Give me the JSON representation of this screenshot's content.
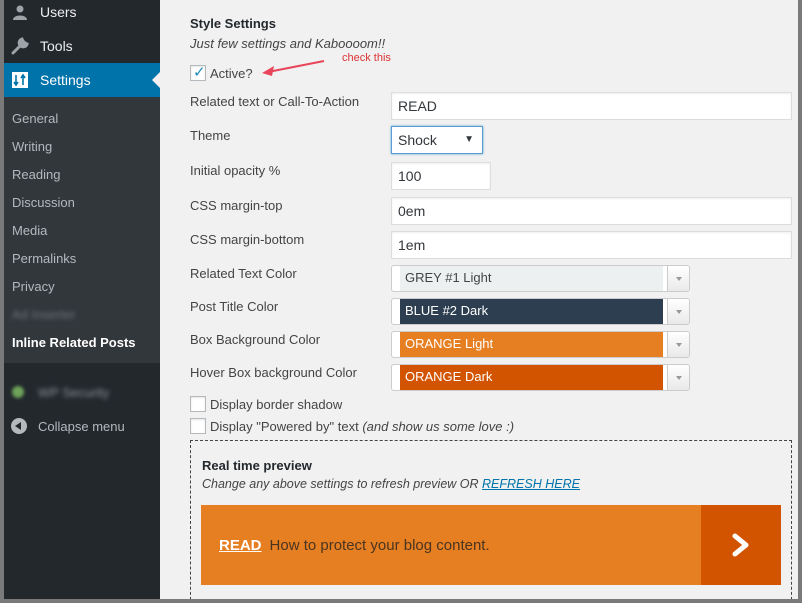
{
  "sidebar": {
    "top_items": [
      {
        "label": "Users",
        "icon": "user-icon"
      },
      {
        "label": "Tools",
        "icon": "wrench-icon"
      },
      {
        "label": "Settings",
        "icon": "settings-sliders-icon",
        "active": true
      }
    ],
    "sub_items": [
      {
        "label": "General"
      },
      {
        "label": "Writing"
      },
      {
        "label": "Reading"
      },
      {
        "label": "Discussion"
      },
      {
        "label": "Media"
      },
      {
        "label": "Permalinks"
      },
      {
        "label": "Privacy"
      },
      {
        "label": "Ad Inserter",
        "blurred": true
      },
      {
        "label": "Inline Related Posts",
        "current": true
      }
    ],
    "security_item": {
      "label": "WP Security",
      "blurred": true
    },
    "collapse_label": "Collapse menu"
  },
  "main": {
    "title": "Style Settings",
    "subtitle": "Just few settings and Kaboooom!!",
    "active_checkbox": {
      "label": "Active?",
      "checked": true
    },
    "annotation": "check this",
    "fields": {
      "cta": {
        "label": "Related text or Call-To-Action",
        "value": "READ"
      },
      "theme": {
        "label": "Theme",
        "value": "Shock"
      },
      "opacity": {
        "label": "Initial opacity %",
        "value": "100"
      },
      "margin_top": {
        "label": "CSS margin-top",
        "value": "0em"
      },
      "margin_bottom": {
        "label": "CSS margin-bottom",
        "value": "1em"
      }
    },
    "colors": [
      {
        "label": "Related Text Color",
        "value": "GREY #1 Light",
        "bg": "#ecf0f1",
        "fg": "#444444"
      },
      {
        "label": "Post Title Color",
        "value": "BLUE #2 Dark",
        "bg": "#2c3e50",
        "fg": "#ffffff"
      },
      {
        "label": "Box Background Color",
        "value": "ORANGE Light",
        "bg": "#e67e22",
        "fg": "#ffffff"
      },
      {
        "label": "Hover Box background Color",
        "value": "ORANGE Dark",
        "bg": "#d35400",
        "fg": "#ffffff"
      }
    ],
    "border_shadow": {
      "label": "Display border shadow",
      "checked": false
    },
    "powered_by": {
      "label": "Display \"Powered by\" text",
      "note": "(and show us some love :)",
      "checked": false
    },
    "preview": {
      "title": "Real time preview",
      "subtitle": "Change any above settings to refresh preview OR",
      "refresh_link": "REFRESH HERE",
      "cta": "READ",
      "post_title": "How to protect your blog content."
    }
  }
}
